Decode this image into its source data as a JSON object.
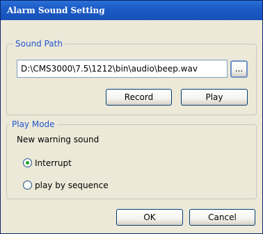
{
  "window": {
    "title": "Alarm Sound Setting"
  },
  "sound_path": {
    "legend": "Sound Path",
    "path_value": "D:\\CMS3000\\7.5\\1212\\bin\\audio\\beep.wav",
    "browse_label": "...",
    "record_label": "Record",
    "play_label": "Play"
  },
  "play_mode": {
    "legend": "Play Mode",
    "description": "New warning sound",
    "options": [
      {
        "label": "Interrupt",
        "selected": true
      },
      {
        "label": "play by sequence",
        "selected": false
      }
    ]
  },
  "footer": {
    "ok_label": "OK",
    "cancel_label": "Cancel"
  },
  "colors": {
    "title_bar": "#1c5cc7",
    "group_legend": "#2255cc",
    "radio_selected": "#21a121"
  }
}
